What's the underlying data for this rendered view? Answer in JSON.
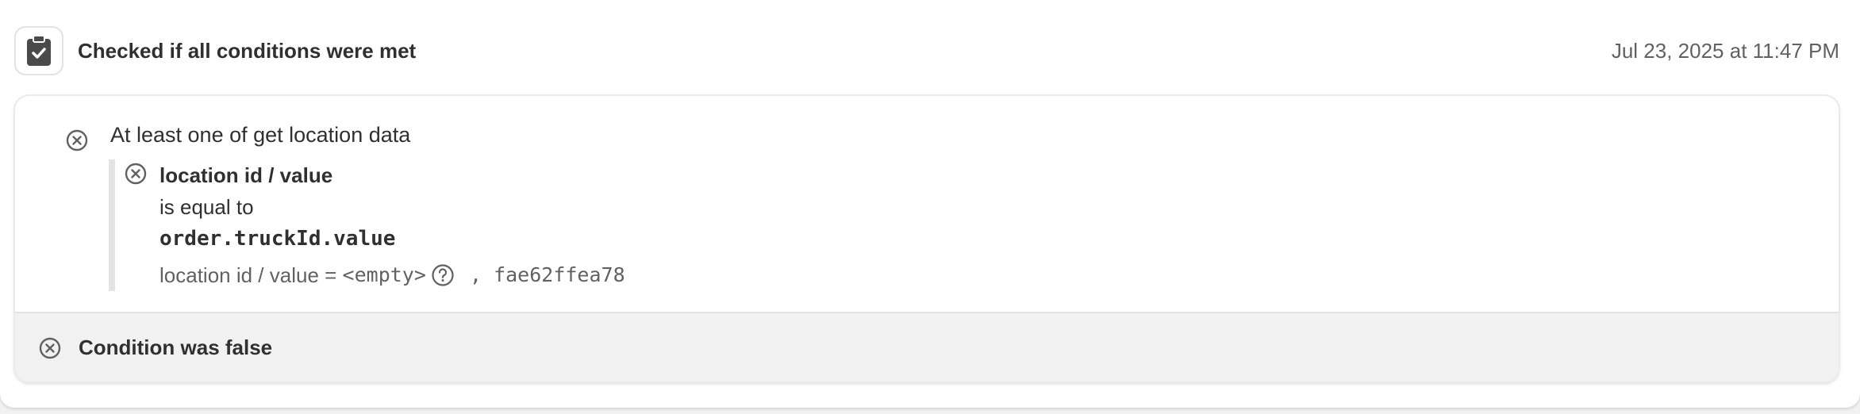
{
  "header": {
    "title": "Checked if all conditions were met",
    "timestamp": "Jul 23, 2025 at 11:47 PM",
    "icon": "clipboard-check-icon"
  },
  "condition": {
    "status_icon": "x-circle-icon",
    "title": "At least one of get location data",
    "nested": {
      "status_icon": "x-circle-icon",
      "field": "location id / value",
      "operator": "is equal to",
      "compare_to": "order.truckId.value",
      "result_prefix": "location id / value = ",
      "result_empty": "<empty>",
      "result_help_icon": "question-circle-icon",
      "result_separator": " , ",
      "result_value": "fae62ffea78"
    }
  },
  "footer": {
    "status_icon": "x-circle-icon",
    "text": "Condition was false"
  },
  "colors": {
    "text_primary": "#303030",
    "text_secondary": "#616161",
    "icon_dark": "#4a4a4a",
    "footer_bg": "#f1f1f1",
    "border": "#e3e3e3"
  }
}
